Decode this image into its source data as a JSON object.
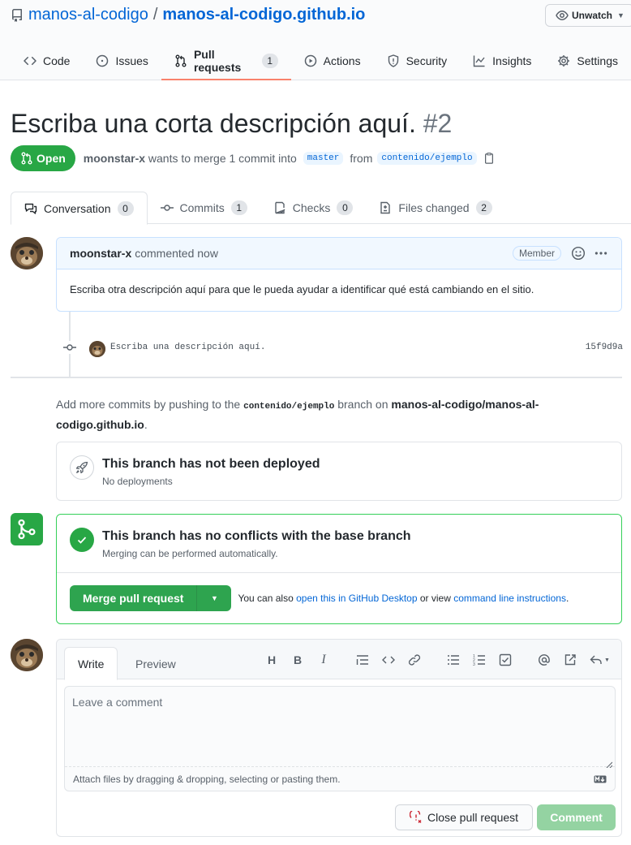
{
  "repo": {
    "owner": "manos-al-codigo",
    "separator": "/",
    "name": "manos-al-codigo.github.io",
    "unwatch_label": "Unwatch"
  },
  "nav_tabs": [
    {
      "label": "Code",
      "icon": "code-icon"
    },
    {
      "label": "Issues",
      "icon": "issue-icon"
    },
    {
      "label": "Pull requests",
      "icon": "pull-request-icon",
      "count": "1",
      "active": true
    },
    {
      "label": "Actions",
      "icon": "play-icon"
    },
    {
      "label": "Security",
      "icon": "shield-icon"
    },
    {
      "label": "Insights",
      "icon": "graph-icon"
    },
    {
      "label": "Settings",
      "icon": "gear-icon"
    }
  ],
  "pr": {
    "title": "Escriba una corta descripción aquí.",
    "number": "#2",
    "state": "Open",
    "author": "moonstar-x",
    "merge_text": "wants to merge 1 commit into",
    "base_branch": "master",
    "from_text": "from",
    "head_branch": "contenido/ejemplo"
  },
  "pr_tabs": [
    {
      "label": "Conversation",
      "count": "0",
      "icon": "comment-discussion-icon"
    },
    {
      "label": "Commits",
      "count": "1",
      "icon": "commit-icon"
    },
    {
      "label": "Checks",
      "count": "0",
      "icon": "checklist-icon"
    },
    {
      "label": "Files changed",
      "count": "2",
      "icon": "file-diff-icon"
    }
  ],
  "comment": {
    "author": "moonstar-x",
    "time": "commented now",
    "badge": "Member",
    "body": "Escriba otra descripción aquí para que le pueda ayudar a identificar qué está cambiando en el sitio."
  },
  "commit": {
    "message": "Escriba una descripción aquí.",
    "sha": "15f9d9a"
  },
  "push_note": {
    "prefix": "Add more commits by pushing to the",
    "branch": "contenido/ejemplo",
    "middle": "branch on",
    "repo_line1": "manos-al-codigo/manos-al-",
    "repo_line2": "codigo.github.io",
    "suffix": "."
  },
  "deploy": {
    "title": "This branch has not been deployed",
    "subtitle": "No deployments"
  },
  "merge": {
    "title": "This branch has no conflicts with the base branch",
    "subtitle": "Merging can be performed automatically.",
    "button": "Merge pull request",
    "also_prefix": "You can also",
    "desktop_link": "open this in GitHub Desktop",
    "or_view": "or view",
    "cli_link": "command line instructions",
    "period": "."
  },
  "editor": {
    "tab_write": "Write",
    "tab_preview": "Preview",
    "placeholder": "Leave a comment",
    "attach_text": "Attach files by dragging & dropping, selecting or pasting them.",
    "close_button": "Close pull request",
    "comment_button": "Comment"
  },
  "colors": {
    "accent": "#0366d6",
    "success": "#28a745",
    "tab_underline": "#f9826c"
  }
}
